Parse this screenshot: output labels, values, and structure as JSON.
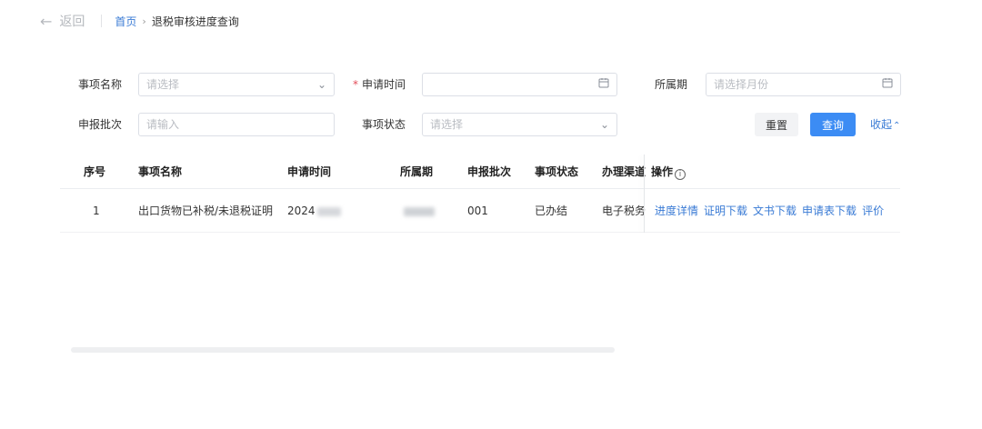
{
  "header": {
    "back_label": "返回",
    "breadcrumb_home": "首页",
    "breadcrumb_current": "退税审核进度查询"
  },
  "form": {
    "item_name_label": "事项名称",
    "item_name_placeholder": "请选择",
    "apply_time_required": "*",
    "apply_time_label": "申请时间",
    "apply_time_placeholder": "",
    "period_label": "所属期",
    "period_placeholder": "请选择月份",
    "batch_label": "申报批次",
    "batch_placeholder": "请输入",
    "status_label": "事项状态",
    "status_placeholder": "请选择",
    "reset_label": "重置",
    "query_label": "查询",
    "collapse_label": "收起"
  },
  "icons": {
    "back": "arrow-left-icon",
    "dropdown": "chevron-down-icon",
    "calendar": "calendar-icon",
    "collapse": "chevron-up-icon",
    "info": "info-circle-icon"
  },
  "colors": {
    "primary": "#3c8cf4",
    "link": "#3a7bd5"
  },
  "table": {
    "columns": [
      "序号",
      "事项名称",
      "申请时间",
      "所属期",
      "申报批次",
      "事项状态",
      "办理渠道",
      "操作"
    ],
    "rows": [
      {
        "index": "1",
        "item_name": "出口货物已补税/未退税证明",
        "apply_time": "2024",
        "period": "",
        "batch": "001",
        "status": "已办结",
        "channel": "电子税务",
        "actions": [
          "进度详情",
          "证明下载",
          "文书下载",
          "申请表下载",
          "评价"
        ]
      }
    ]
  }
}
